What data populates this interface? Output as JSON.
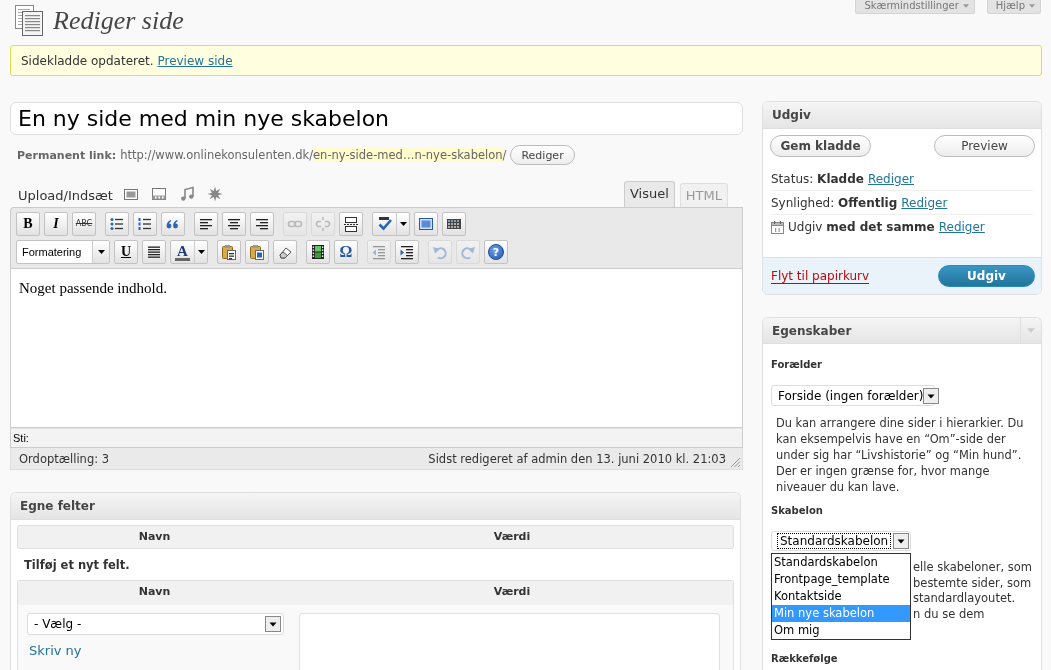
{
  "header": {
    "title": "Rediger side",
    "screen_tabs": [
      "Skærmindstillinger",
      "Hjælp"
    ]
  },
  "notice": {
    "text": "Sidekladde opdateret.",
    "link": "Preview side"
  },
  "title_field": {
    "value": "En ny side med min nye skabelon"
  },
  "permalink": {
    "label": "Permanent link:",
    "base": "http://www.onlinekonsulenten.dk/",
    "slug": "en-ny-side-med…n-nye-skabelon",
    "trail": "/",
    "button": "Rediger"
  },
  "editor": {
    "upload_label": "Upload/Indsæt",
    "tabs": [
      {
        "label": "Visuel",
        "selected": true
      },
      {
        "label": "HTML",
        "selected": false
      }
    ],
    "toolbar": [
      [
        [
          {
            "kind": "bold",
            "label": "B",
            "disabled": false
          },
          {
            "kind": "italic",
            "label": "I",
            "disabled": false
          },
          {
            "kind": "strike",
            "label": "ABC",
            "disabled": false
          }
        ],
        [
          {
            "kind": "bullets",
            "disabled": false
          },
          {
            "kind": "numbers",
            "disabled": false
          },
          {
            "kind": "quote",
            "disabled": false
          }
        ],
        [
          {
            "kind": "left",
            "disabled": false
          },
          {
            "kind": "center",
            "disabled": false
          },
          {
            "kind": "right",
            "disabled": false
          }
        ],
        [
          {
            "kind": "link",
            "disabled": true
          },
          {
            "kind": "unlink",
            "disabled": true
          },
          {
            "kind": "more",
            "disabled": false
          }
        ],
        [
          {
            "kind": "spell",
            "disabled": false
          },
          {
            "kind": "fullscreen",
            "disabled": false
          },
          {
            "kind": "sink",
            "disabled": false
          }
        ]
      ],
      [
        [
          {
            "kind": "format",
            "label": "Formatering",
            "disabled": false
          },
          {
            "kind": "underline",
            "label": "U",
            "disabled": false
          },
          {
            "kind": "justify",
            "disabled": false
          },
          {
            "kind": "color",
            "label": "A",
            "disabled": false
          }
        ],
        [
          {
            "kind": "pastetext",
            "disabled": false
          },
          {
            "kind": "pasteword",
            "disabled": false
          },
          {
            "kind": "eraser",
            "disabled": false
          }
        ],
        [
          {
            "kind": "media",
            "disabled": false
          },
          {
            "kind": "charmap",
            "label": "Ω",
            "disabled": false
          }
        ],
        [
          {
            "kind": "outdent",
            "disabled": true
          },
          {
            "kind": "indent",
            "disabled": false
          }
        ],
        [
          {
            "kind": "undo",
            "disabled": true
          },
          {
            "kind": "redo",
            "disabled": true
          },
          {
            "kind": "help",
            "label": "?",
            "disabled": false
          }
        ]
      ]
    ],
    "content": "Noget passende indhold.",
    "path_label": "Sti:",
    "word_count": "Ordoptælling: 3",
    "last_edited": "Sidst redigeret af admin den 13. juni 2010 kl. 21:03"
  },
  "custom_fields": {
    "title": "Egne felter",
    "columns": [
      "Navn",
      "Værdi"
    ],
    "add_title": "Tilføj et nyt felt.",
    "new_columns": [
      "Navn",
      "Værdi"
    ],
    "key_select": "- Vælg -",
    "new_link": "Skriv ny"
  },
  "publish": {
    "title": "Udgiv",
    "save_button": "Gem kladde",
    "preview_button": "Preview",
    "rows": [
      {
        "kind": "plain",
        "label": "Status:",
        "value": "Kladde",
        "link": "Rediger"
      },
      {
        "kind": "plain",
        "label": "Synlighed:",
        "value": "Offentlig",
        "link": "Rediger"
      },
      {
        "kind": "schedule",
        "label": "Udgiv",
        "value": "med det samme",
        "link": "Rediger"
      }
    ],
    "trash_link": "Flyt til papirkurv",
    "publish_button": "Udgiv"
  },
  "attributes": {
    "title": "Egenskaber",
    "parent_label": "Forælder",
    "parent_select": "Forside (ingen forælder)",
    "parent_help": "Du kan arrangere dine sider i hierarkier. Du kan eksempelvis have en “Om”-side der under sig har “Livshistorie” og “Min hund”. Der er ingen grænse for, hvor mange niveauer du kan lave.",
    "template_label": "Skabelon",
    "template_select": "Standardskabelon",
    "template_options": [
      {
        "label": "Standardskabelon",
        "selected": false
      },
      {
        "label": "Frontpage_template",
        "selected": false
      },
      {
        "label": "Kontaktside",
        "selected": false
      },
      {
        "label": "Min nye skabelon",
        "selected": true
      },
      {
        "label": "Om mig",
        "selected": false
      }
    ],
    "template_help_lines": [
      "elle skabeloner, som",
      "bestemte sider, som",
      "standardlayoutet.",
      "n du se dem"
    ],
    "order_label": "Rækkefølge"
  }
}
